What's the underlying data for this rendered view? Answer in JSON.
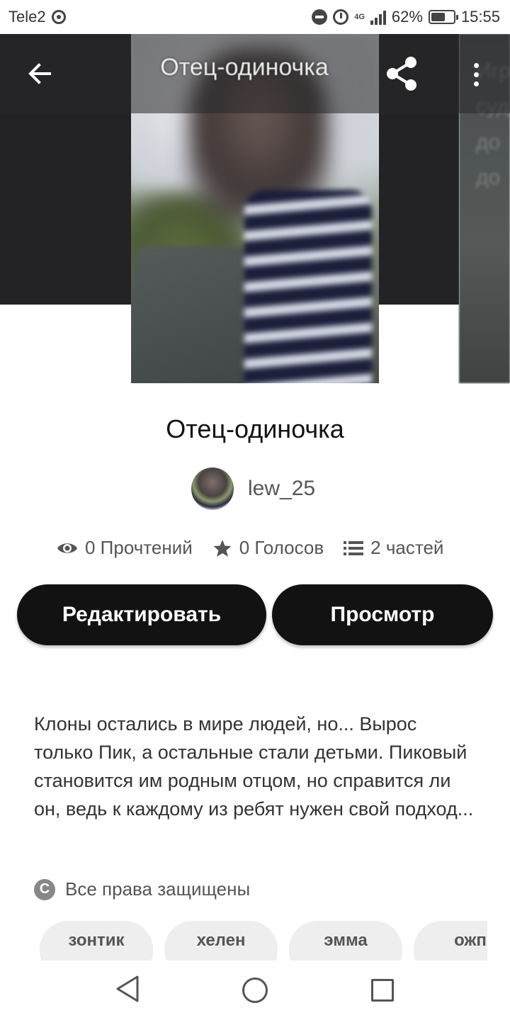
{
  "status_bar": {
    "carrier": "Tele2",
    "network": "4G",
    "battery_percent": "62%",
    "battery_level": 0.62,
    "time": "15:55"
  },
  "toolbar": {
    "title": "Отец-одиночка",
    "back_icon": "arrow-left-icon",
    "share_icon": "share-icon",
    "menu_icon": "more-vertical-icon"
  },
  "next_cover_text": "Игр\nсуд\nдо\nдо",
  "story": {
    "title": "Отец-одиночка",
    "author": "lew_25",
    "reads": "0 Прочтений",
    "votes": "0 Голосов",
    "parts": "2 частей",
    "edit_label": "Редактировать",
    "view_label": "Просмотр",
    "description": "Клоны остались в мире людей, но... Вырос только Пик, а остальные стали детьми. Пиковый становится им родным отцом, но справится ли он, ведь к каждому из ребят нужен свой подход...",
    "copyright": "Все права защищены",
    "copyright_icon_glyph": "C",
    "tags": [
      "зонтик",
      "хелен",
      "эмма",
      "ожп"
    ]
  },
  "colors": {
    "accent_dark": "#121212",
    "tag_bg": "#eeeeee",
    "hero_dark": "#232325"
  }
}
